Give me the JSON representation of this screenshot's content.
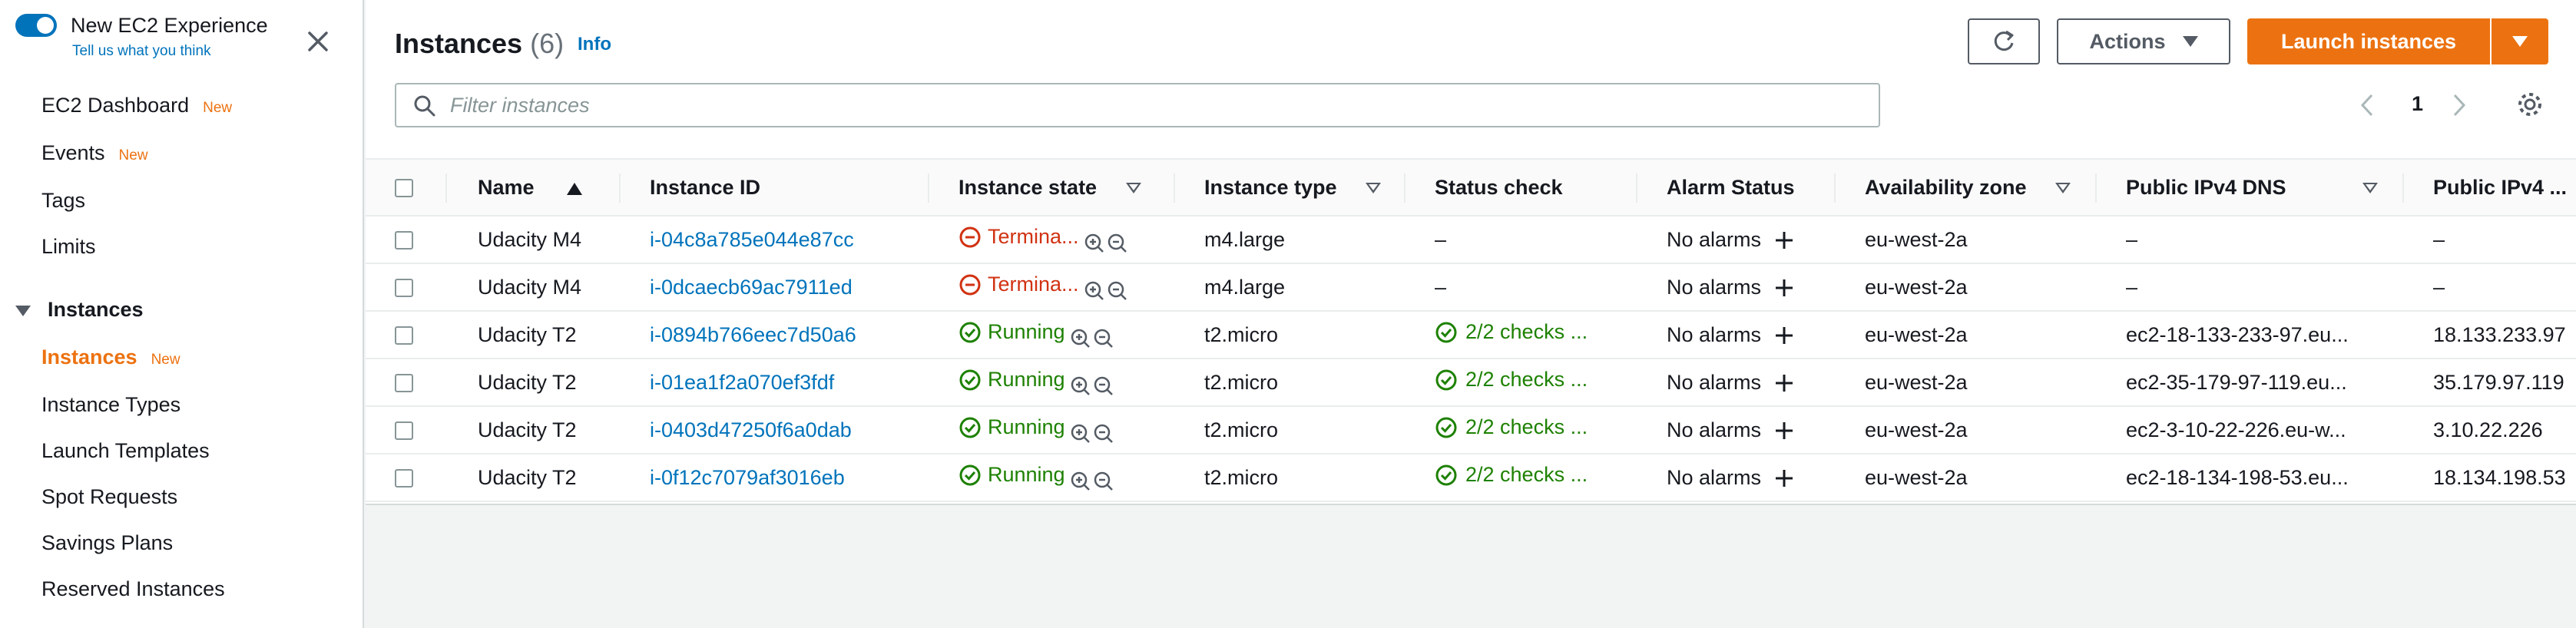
{
  "sidebar": {
    "experience_title": "New EC2 Experience",
    "experience_link": "Tell us what you think",
    "items": [
      {
        "label": "EC2 Dashboard",
        "badge": "New"
      },
      {
        "label": "Events",
        "badge": "New"
      },
      {
        "label": "Tags",
        "badge": ""
      },
      {
        "label": "Limits",
        "badge": ""
      }
    ],
    "section_label": "Instances",
    "section_items": [
      {
        "label": "Instances",
        "badge": "New",
        "active": true
      },
      {
        "label": "Instance Types",
        "badge": ""
      },
      {
        "label": "Launch Templates",
        "badge": ""
      },
      {
        "label": "Spot Requests",
        "badge": ""
      },
      {
        "label": "Savings Plans",
        "badge": ""
      },
      {
        "label": "Reserved Instances",
        "badge": ""
      }
    ]
  },
  "header": {
    "title": "Instances",
    "count": "(6)",
    "info_label": "Info",
    "actions_label": "Actions",
    "launch_label": "Launch instances",
    "page_number": "1"
  },
  "search": {
    "placeholder": "Filter instances",
    "value": ""
  },
  "table": {
    "columns": [
      "Name",
      "Instance ID",
      "Instance state",
      "Instance type",
      "Status check",
      "Alarm Status",
      "Availability zone",
      "Public IPv4 DNS",
      "Public IPv4 ..."
    ],
    "rows": [
      {
        "name": "Udacity M4",
        "id": "i-04c8a785e044e87cc",
        "state": "Termina...",
        "state_kind": "terminated",
        "type": "m4.large",
        "status": "–",
        "alarm": "No alarms",
        "az": "eu-west-2a",
        "dns": "–",
        "ip": "–"
      },
      {
        "name": "Udacity M4",
        "id": "i-0dcaecb69ac7911ed",
        "state": "Termina...",
        "state_kind": "terminated",
        "type": "m4.large",
        "status": "–",
        "alarm": "No alarms",
        "az": "eu-west-2a",
        "dns": "–",
        "ip": "–"
      },
      {
        "name": "Udacity T2",
        "id": "i-0894b766eec7d50a6",
        "state": "Running",
        "state_kind": "running",
        "type": "t2.micro",
        "status": "2/2 checks ...",
        "alarm": "No alarms",
        "az": "eu-west-2a",
        "dns": "ec2-18-133-233-97.eu...",
        "ip": "18.133.233.97"
      },
      {
        "name": "Udacity T2",
        "id": "i-01ea1f2a070ef3fdf",
        "state": "Running",
        "state_kind": "running",
        "type": "t2.micro",
        "status": "2/2 checks ...",
        "alarm": "No alarms",
        "az": "eu-west-2a",
        "dns": "ec2-35-179-97-119.eu...",
        "ip": "35.179.97.119"
      },
      {
        "name": "Udacity T2",
        "id": "i-0403d47250f6a0dab",
        "state": "Running",
        "state_kind": "running",
        "type": "t2.micro",
        "status": "2/2 checks ...",
        "alarm": "No alarms",
        "az": "eu-west-2a",
        "dns": "ec2-3-10-22-226.eu-w...",
        "ip": "3.10.22.226"
      },
      {
        "name": "Udacity T2",
        "id": "i-0f12c7079af3016eb",
        "state": "Running",
        "state_kind": "running",
        "type": "t2.micro",
        "status": "2/2 checks ...",
        "alarm": "No alarms",
        "az": "eu-west-2a",
        "dns": "ec2-18-134-198-53.eu...",
        "ip": "18.134.198.53"
      }
    ]
  },
  "colors": {
    "accent": "#ec7211",
    "link": "#0073bb",
    "running": "#1d8102",
    "terminated": "#d13212"
  }
}
